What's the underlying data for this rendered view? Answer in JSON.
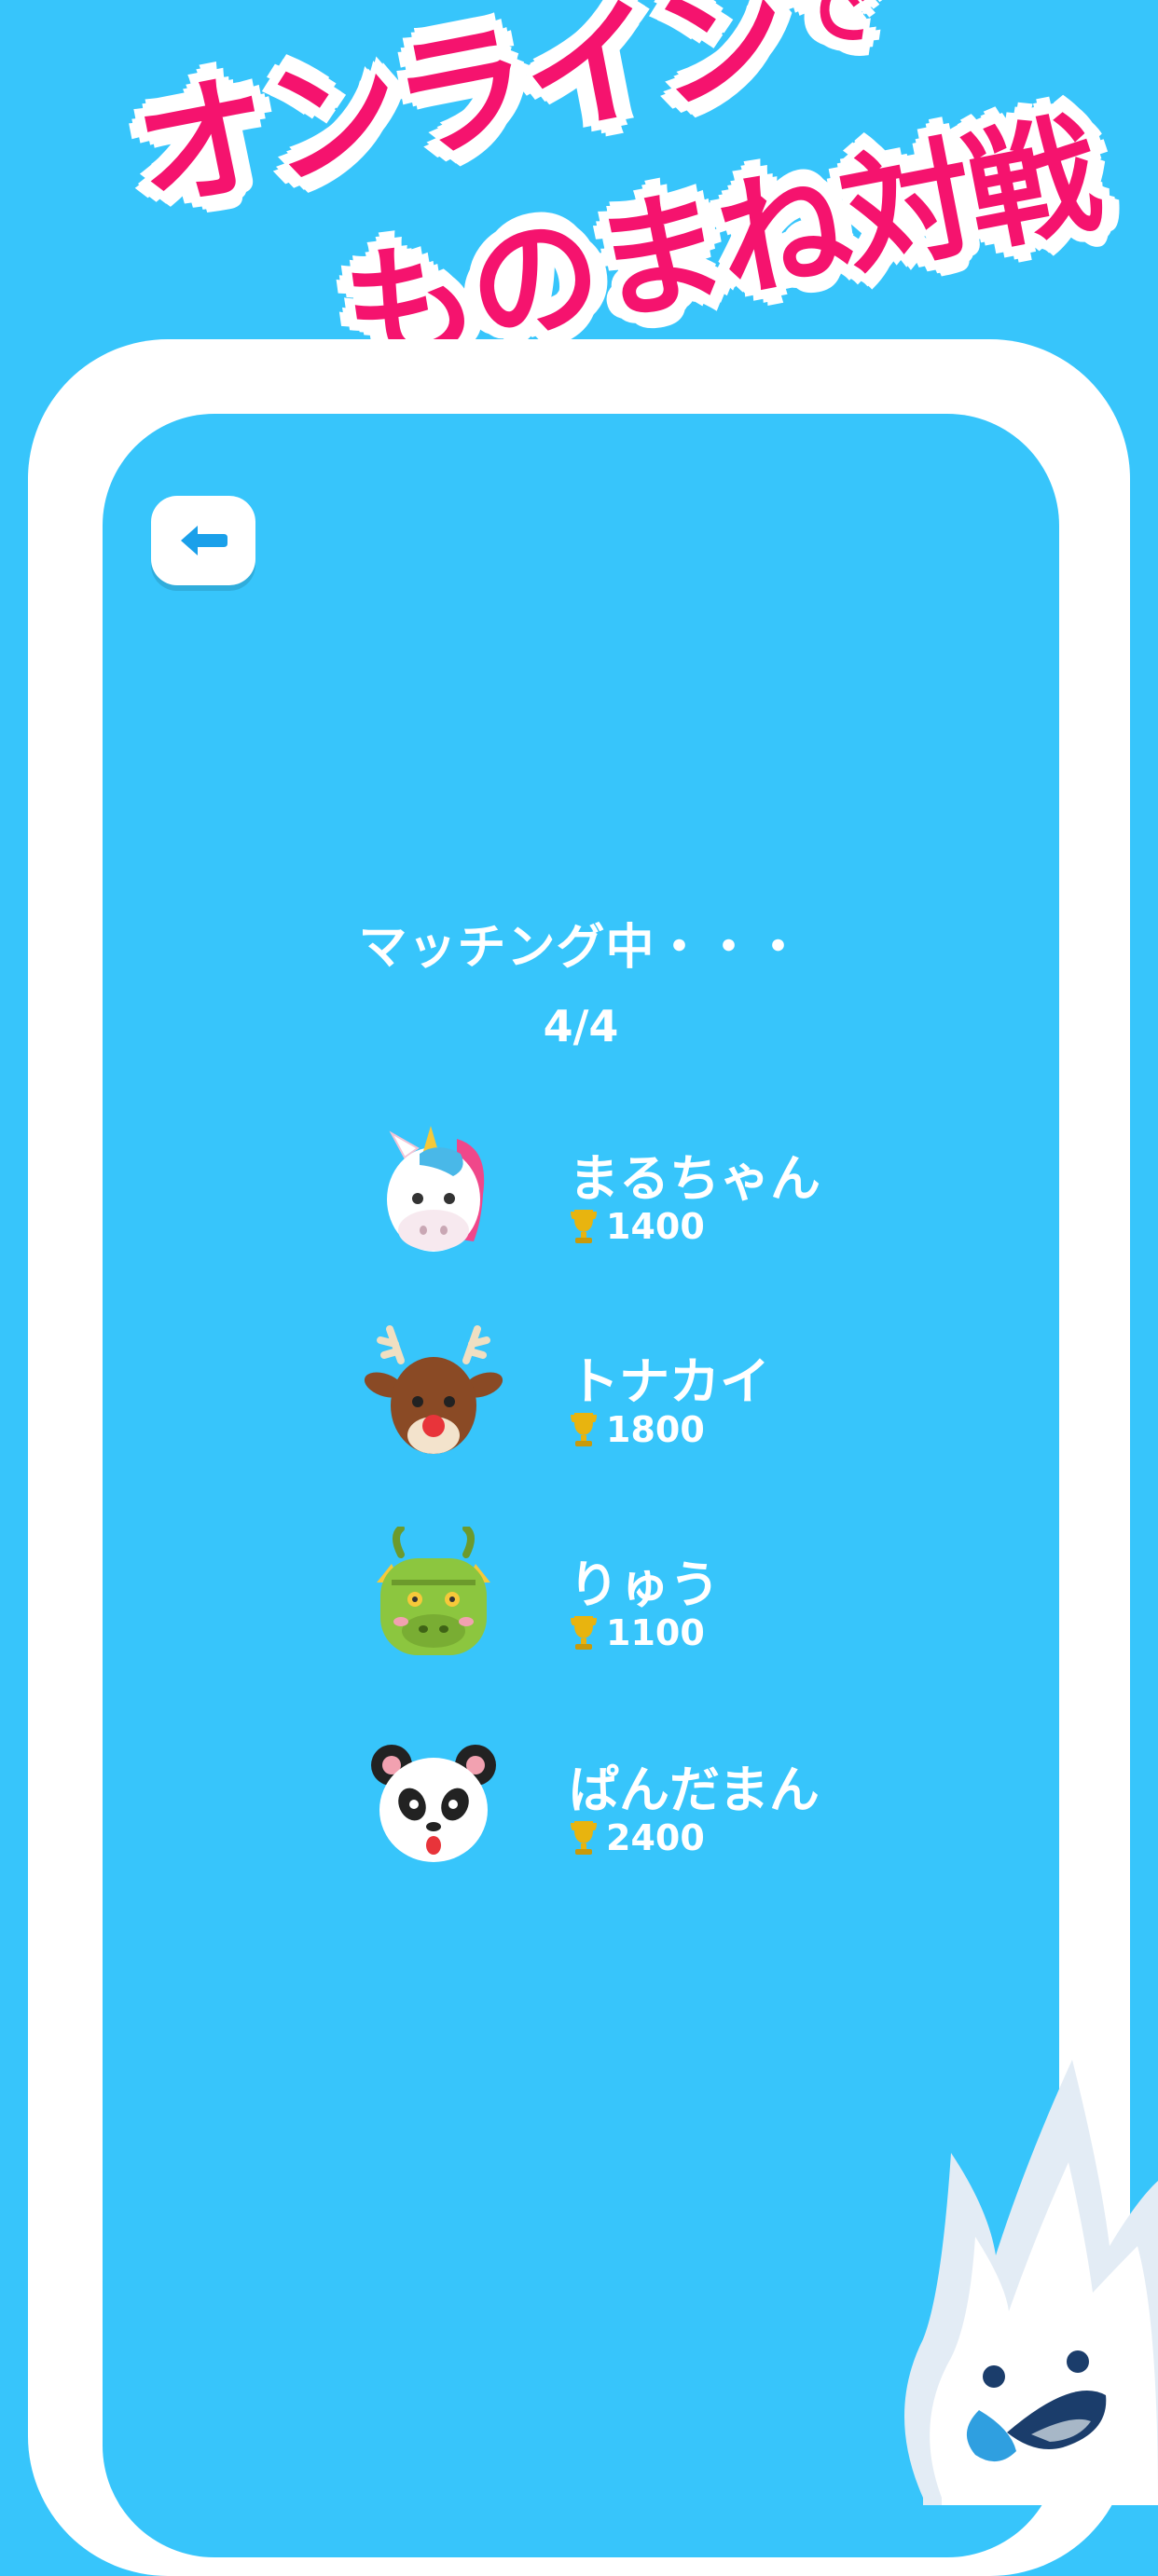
{
  "headline": {
    "line1": "オンライン",
    "line1_suffix": "で",
    "line2": "ものまね対戦"
  },
  "screen": {
    "back_icon": "arrow-left-icon",
    "status_title": "マッチング中・・・",
    "player_count": "4/4",
    "players": [
      {
        "name": "まるちゃん",
        "score": "1400",
        "avatar": "unicorn-avatar"
      },
      {
        "name": "トナカイ",
        "score": "1800",
        "avatar": "reindeer-avatar"
      },
      {
        "name": "りゅう",
        "score": "1100",
        "avatar": "dragon-avatar"
      },
      {
        "name": "ぱんだまん",
        "score": "2400",
        "avatar": "panda-avatar"
      }
    ]
  },
  "colors": {
    "background": "#37c5fb",
    "headline": "#f5136e",
    "device_frame": "#ffffff",
    "back_arrow": "#1aa0ea",
    "trophy": "#e8b40f"
  }
}
